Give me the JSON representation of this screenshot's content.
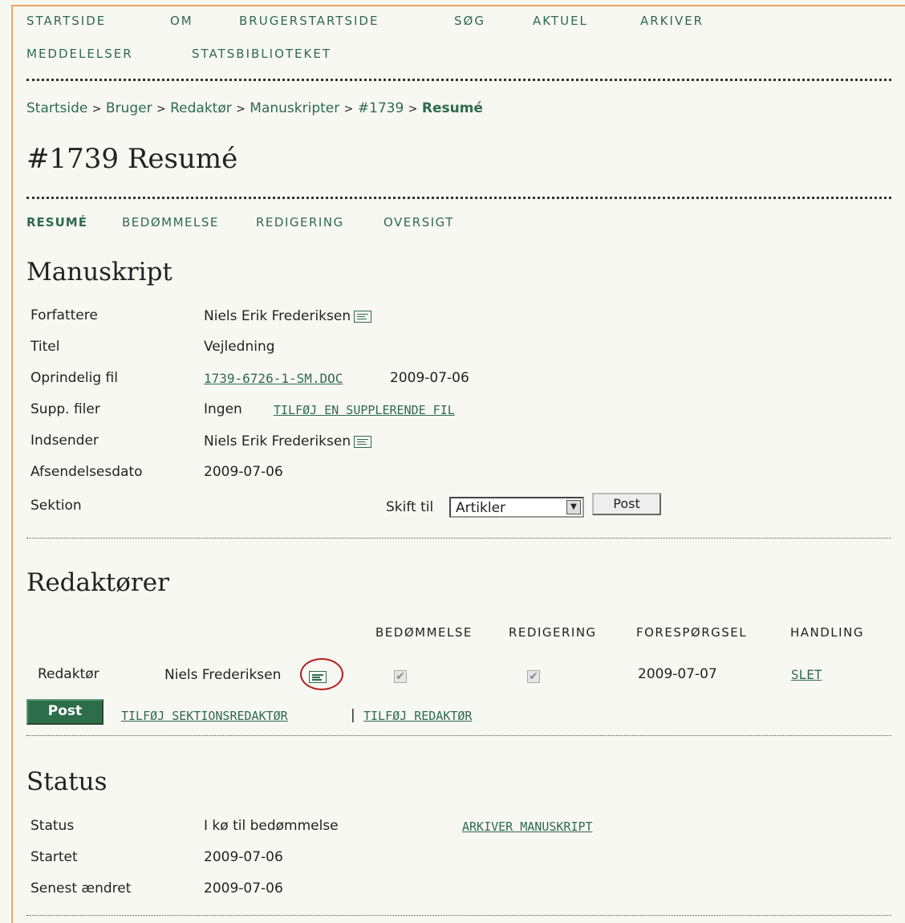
{
  "nav": {
    "row1": [
      "STARTSIDE",
      "OM",
      "BRUGERSTARTSIDE",
      "SØG",
      "AKTUEL",
      "ARKIVER"
    ],
    "row2": [
      "MEDDELELSER",
      "STATSBIBLIOTEKET"
    ]
  },
  "breadcrumb": {
    "items": [
      "Startside",
      "Bruger",
      "Redaktør",
      "Manuskripter",
      "#1739"
    ],
    "current": "Resumé",
    "separator": ">"
  },
  "page_title": "#1739 Resumé",
  "tabs": {
    "active": "RESUMÉ",
    "others": [
      "BEDØMMELSE",
      "REDIGERING",
      "OVERSIGT"
    ]
  },
  "manuskript": {
    "heading": "Manuskript",
    "labels": {
      "authors": "Forfattere",
      "title": "Titel",
      "orig_file": "Oprindelig fil",
      "supp_files": "Supp. filer",
      "submitter": "Indsender",
      "date": "Afsendelsesdato",
      "section": "Sektion"
    },
    "authors": "Niels Erik Frederiksen",
    "title": "Vejledning",
    "orig_file_link": "1739-6726-1-SM.DOC",
    "orig_file_date": "2009-07-06",
    "supp_files": "Ingen",
    "add_supp_link": "TILFØJ EN SUPPLERENDE FIL",
    "submitter": "Niels Erik Frederiksen",
    "date": "2009-07-06",
    "switch_label": "Skift til",
    "section_selected": "Artikler",
    "post_button": "Post"
  },
  "redaktorer": {
    "heading": "Redaktører",
    "columns": [
      "BEDØMMELSE",
      "REDIGERING",
      "FORESPØRGSEL",
      "HANDLING"
    ],
    "row": {
      "role": "Redaktør",
      "name": "Niels Frederiksen",
      "review_checked": true,
      "edit_checked": true,
      "request_date": "2009-07-07",
      "action": "SLET"
    },
    "post_button": "Post",
    "add_section_editor": "TILFØJ SEKTIONSREDAKTØR",
    "divider": "|",
    "add_editor": "TILFØJ REDAKTØR"
  },
  "status": {
    "heading": "Status",
    "labels": {
      "status": "Status",
      "started": "Startet",
      "modified": "Senest ændret"
    },
    "status": "I kø til bedømmelse",
    "archive_link": "ARKIVER MANUSKRIPT",
    "started": "2009-07-06",
    "modified": "2009-07-06"
  },
  "colors": {
    "link_green": "#2e6b4d",
    "frame_orange": "#f0a55f",
    "highlight_red": "#b71c1c",
    "button_green": "#2d6e4a"
  }
}
